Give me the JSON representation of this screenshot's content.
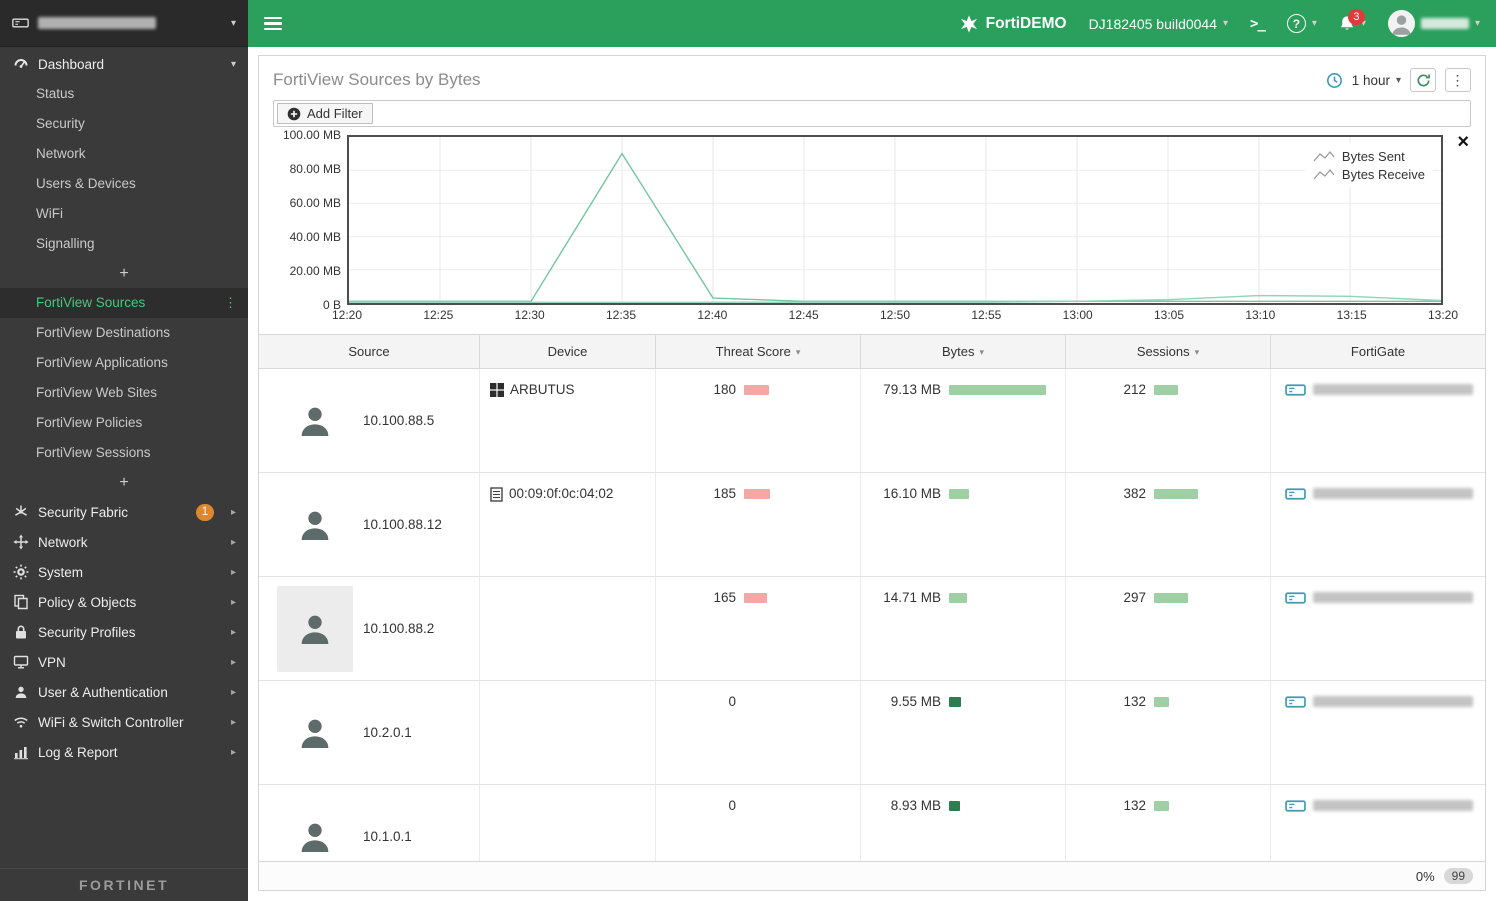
{
  "colors": {
    "topbar_green": "#2aa05c",
    "selected_green": "#4fc47d",
    "threat_bar": "#f2a9a4",
    "bytes_bar_light": "#9fd0a4",
    "bytes_bar_dark": "#2e7d4f",
    "sessions_bar": "#9fd0a4",
    "badge_orange": "#e0862c",
    "badge_red": "#e23b3b",
    "chart_line_sent": "#74c6a2",
    "chart_line_receive": "#8ed4b8",
    "fortigate_icon_teal": "#3f9bb5"
  },
  "topbar": {
    "brand": "FortiDEMO",
    "build": "DJ182405 build0044",
    "notification_count": "3",
    "console_glyph": ">_",
    "help_glyph": "?"
  },
  "sidebar": {
    "dashboard_label": "Dashboard",
    "dashboard_items": [
      "Status",
      "Security",
      "Network",
      "Users & Devices",
      "WiFi",
      "Signalling"
    ],
    "fortiview_selected": "FortiView Sources",
    "fortiview_items": [
      "FortiView Destinations",
      "FortiView Applications",
      "FortiView Web Sites",
      "FortiView Policies",
      "FortiView Sessions"
    ],
    "add_widget_glyph": "+",
    "menu_items": [
      {
        "label": "Security Fabric",
        "icon": "security-fabric-icon",
        "badge": "1"
      },
      {
        "label": "Network",
        "icon": "network-icon"
      },
      {
        "label": "System",
        "icon": "system-icon"
      },
      {
        "label": "Policy & Objects",
        "icon": "policy-objects-icon"
      },
      {
        "label": "Security Profiles",
        "icon": "security-profiles-icon"
      },
      {
        "label": "VPN",
        "icon": "vpn-icon"
      },
      {
        "label": "User & Authentication",
        "icon": "user-auth-icon"
      },
      {
        "label": "WiFi & Switch Controller",
        "icon": "wifi-switch-icon"
      },
      {
        "label": "Log & Report",
        "icon": "log-report-icon"
      }
    ],
    "logo": "FORTINET"
  },
  "main": {
    "title": "FortiView Sources by Bytes",
    "time_range": "1 hour",
    "add_filter_label": "Add Filter",
    "footer_percent": "0%",
    "footer_badge": "99"
  },
  "chart_data": {
    "type": "line",
    "x": [
      "12:20",
      "12:25",
      "12:30",
      "12:35",
      "12:40",
      "12:45",
      "12:50",
      "12:55",
      "13:00",
      "13:05",
      "13:10",
      "13:15",
      "13:20"
    ],
    "unit": "MB",
    "ylim": [
      0,
      100
    ],
    "yticks": [
      "100.00 MB",
      "80.00 MB",
      "60.00 MB",
      "40.00 MB",
      "20.00 MB",
      "0 B"
    ],
    "legend_position": "top-right",
    "grid": true,
    "series": [
      {
        "name": "Bytes Sent",
        "values": [
          1,
          1,
          1,
          90,
          3,
          1,
          1,
          1,
          1,
          1,
          1,
          1,
          1
        ]
      },
      {
        "name": "Bytes Receive",
        "values": [
          0.5,
          0.5,
          0.5,
          0.5,
          0.5,
          0.5,
          0.5,
          0.5,
          1,
          2,
          4.5,
          4,
          1.5
        ]
      }
    ]
  },
  "table": {
    "columns": [
      {
        "label": "Source",
        "sortable": false
      },
      {
        "label": "Device",
        "sortable": false
      },
      {
        "label": "Threat Score",
        "sortable": true
      },
      {
        "label": "Bytes",
        "sortable": true
      },
      {
        "label": "Sessions",
        "sortable": true
      },
      {
        "label": "FortiGate",
        "sortable": false
      }
    ],
    "rows": [
      {
        "source": "10.100.88.5",
        "device": "ARBUTUS",
        "device_icon": "windows-icon",
        "threat_score": 180,
        "bytes": "79.13 MB",
        "bytes_mb": 79.13,
        "sessions": 212,
        "bytes_bar": "light",
        "highlight": false
      },
      {
        "source": "10.100.88.12",
        "device": "00:09:0f:0c:04:02",
        "device_icon": "device-icon",
        "threat_score": 185,
        "bytes": "16.10 MB",
        "bytes_mb": 16.1,
        "sessions": 382,
        "bytes_bar": "light",
        "highlight": false
      },
      {
        "source": "10.100.88.2",
        "device": "",
        "device_icon": "",
        "threat_score": 165,
        "bytes": "14.71 MB",
        "bytes_mb": 14.71,
        "sessions": 297,
        "bytes_bar": "light",
        "highlight": true
      },
      {
        "source": "10.2.0.1",
        "device": "",
        "device_icon": "",
        "threat_score": 0,
        "bytes": "9.55 MB",
        "bytes_mb": 9.55,
        "sessions": 132,
        "bytes_bar": "dark",
        "highlight": false
      },
      {
        "source": "10.1.0.1",
        "device": "",
        "device_icon": "",
        "threat_score": 0,
        "bytes": "8.93 MB",
        "bytes_mb": 8.93,
        "sessions": 132,
        "bytes_bar": "dark",
        "highlight": false
      }
    ]
  }
}
